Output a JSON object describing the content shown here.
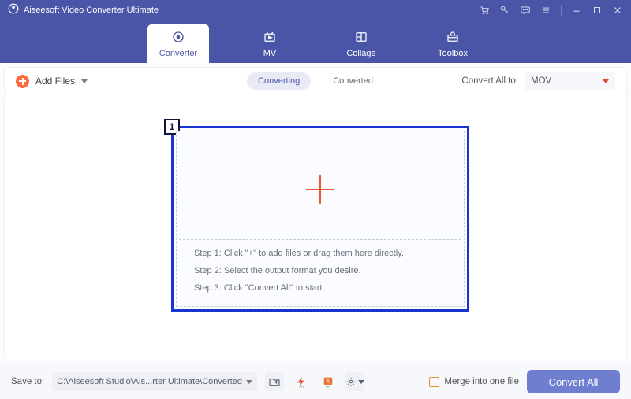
{
  "app": {
    "title": "Aiseesoft Video Converter Ultimate"
  },
  "tabs": {
    "converter": "Converter",
    "mv": "MV",
    "collage": "Collage",
    "toolbox": "Toolbox"
  },
  "toolbar": {
    "addFiles": "Add Files",
    "converting": "Converting",
    "converted": "Converted",
    "convertAllTo": "Convert All to:",
    "format": "MOV"
  },
  "drop": {
    "annotation": "1",
    "step1": "Step 1: Click \"+\" to add files or drag them here directly.",
    "step2": "Step 2: Select the output format you desire.",
    "step3": "Step 3: Click \"Convert All\" to start."
  },
  "footer": {
    "saveToLabel": "Save to:",
    "path": "C:\\Aiseesoft Studio\\Ais...rter Ultimate\\Converted",
    "merge": "Merge into one file",
    "convertAll": "Convert All"
  }
}
